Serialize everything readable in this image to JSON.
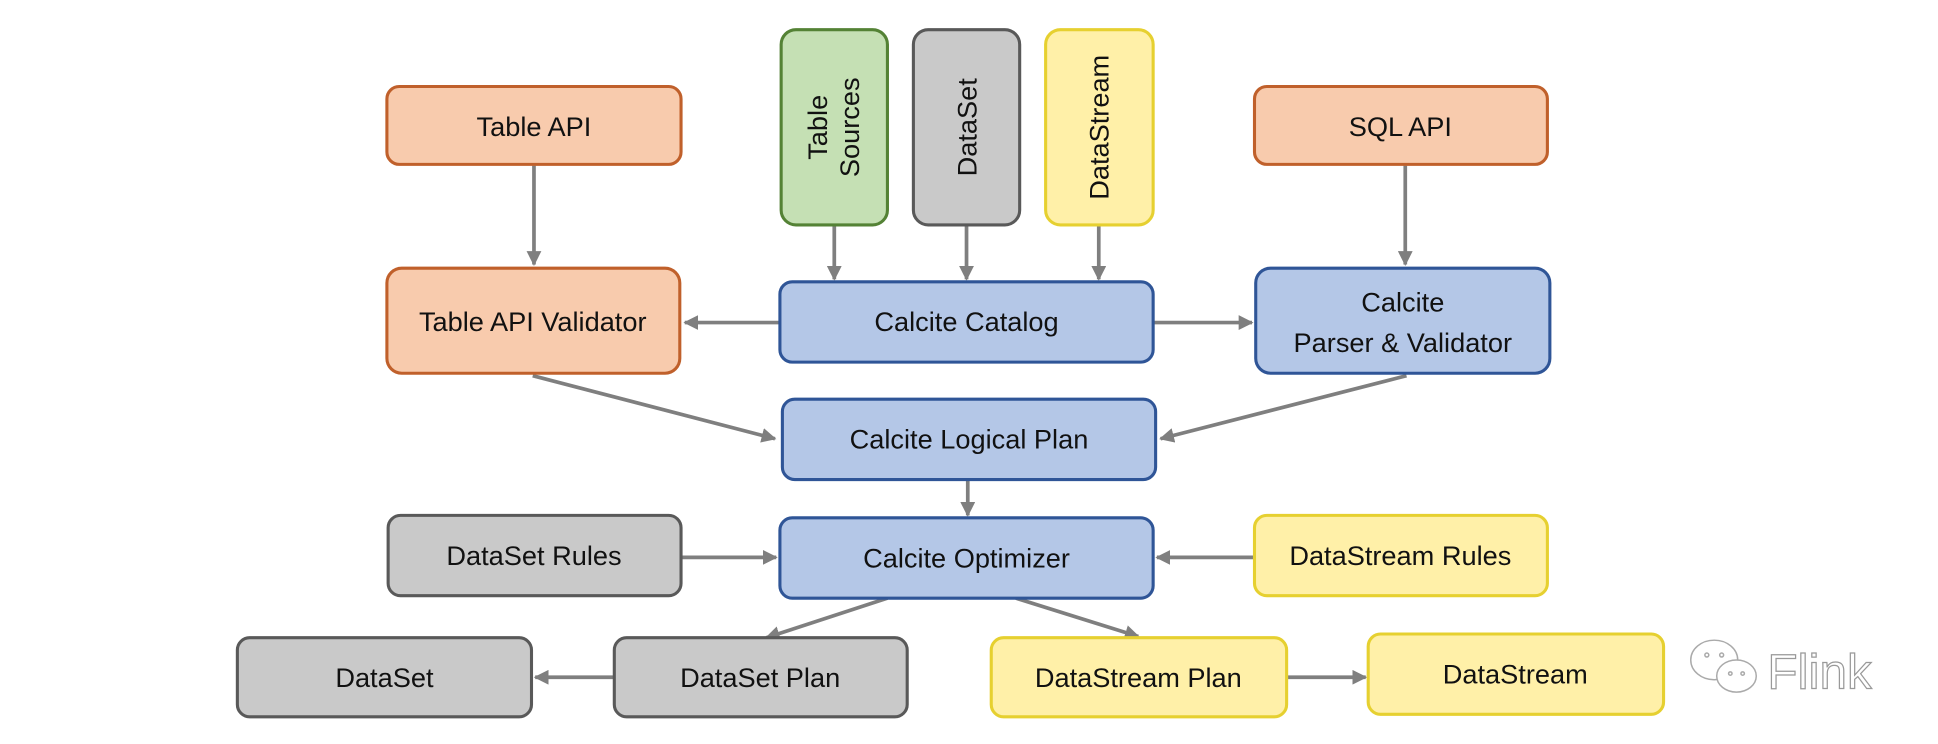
{
  "colors": {
    "orange_fill": "#f8cbad",
    "orange_stroke": "#c0602b",
    "blue_fill": "#b4c7e7",
    "blue_stroke": "#2f5597",
    "green_fill": "#c5e0b4",
    "green_stroke": "#548235",
    "gray_fill": "#c9c9c9",
    "gray_stroke": "#595959",
    "yellow_fill": "#fff0a8",
    "yellow_stroke": "#e6d030",
    "arrow": "#7f7f7f"
  },
  "nodes": {
    "table_api": "Table API",
    "table_sources": [
      "Table",
      "Sources"
    ],
    "dataset_source": "DataSet",
    "datastream_source": "DataStream",
    "sql_api": "SQL API",
    "table_api_validator": "Table API Validator",
    "calcite_catalog": "Calcite Catalog",
    "calcite_parser": [
      "Calcite",
      "Parser & Validator"
    ],
    "calcite_logical_plan": "Calcite Logical Plan",
    "dataset_rules": "DataSet Rules",
    "calcite_optimizer": "Calcite Optimizer",
    "datastream_rules": "DataStream Rules",
    "dataset_out": "DataSet",
    "dataset_plan": "DataSet Plan",
    "datastream_plan": "DataStream Plan",
    "datastream_out": "DataStream"
  },
  "watermark": {
    "text": "Flink",
    "icon": "wechat-icon"
  }
}
